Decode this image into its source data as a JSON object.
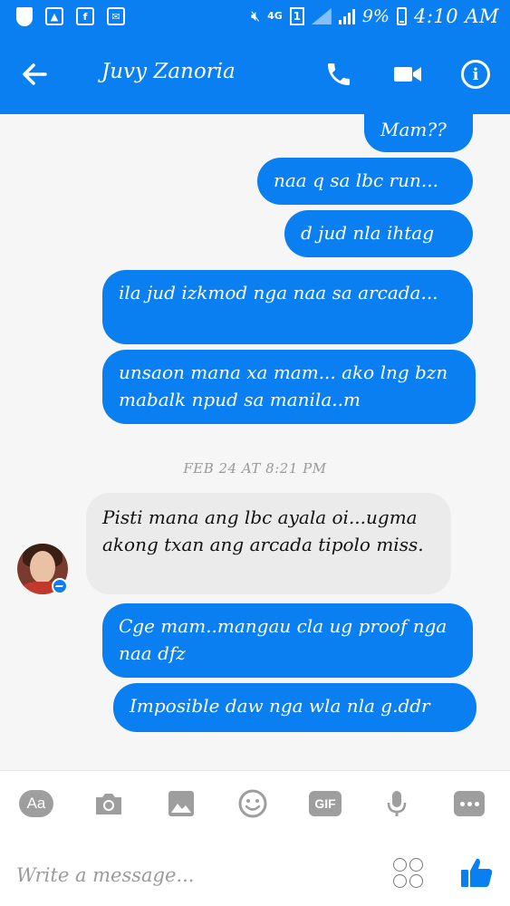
{
  "status_bar": {
    "network": "4G",
    "sim": "1",
    "battery": "9%",
    "time": "4:10 AM"
  },
  "header": {
    "contact_name": "Juvy Zanoria"
  },
  "messages": [
    {
      "from": "me",
      "text": "Mam??"
    },
    {
      "from": "me",
      "text": "naa q sa lbc run..."
    },
    {
      "from": "me",
      "text": "d jud nla ihtag"
    },
    {
      "from": "me",
      "text": "ila jud izkmod nga naa sa arcada..."
    },
    {
      "from": "me",
      "text": "unsaon mana xa mam... ako lng bzn mabalk npud sa manila..m"
    },
    {
      "from": "contact",
      "text": "Pisti mana ang lbc ayala oi...ugma akong txan ang arcada tipolo miss."
    },
    {
      "from": "me",
      "text": "Cge mam..mangau cla ug proof nga naa dfz"
    },
    {
      "from": "me",
      "text": "Imposible daw nga wla nla g.ddr"
    }
  ],
  "date_separator": "FEB 24 AT 8:21 PM",
  "composer": {
    "aa_label": "Aa",
    "gif_label": "GIF",
    "placeholder": "Write a message..."
  },
  "colors": {
    "accent": "#0a7ff2",
    "incoming_bubble": "#ebebeb",
    "background": "#f6f6f6"
  }
}
